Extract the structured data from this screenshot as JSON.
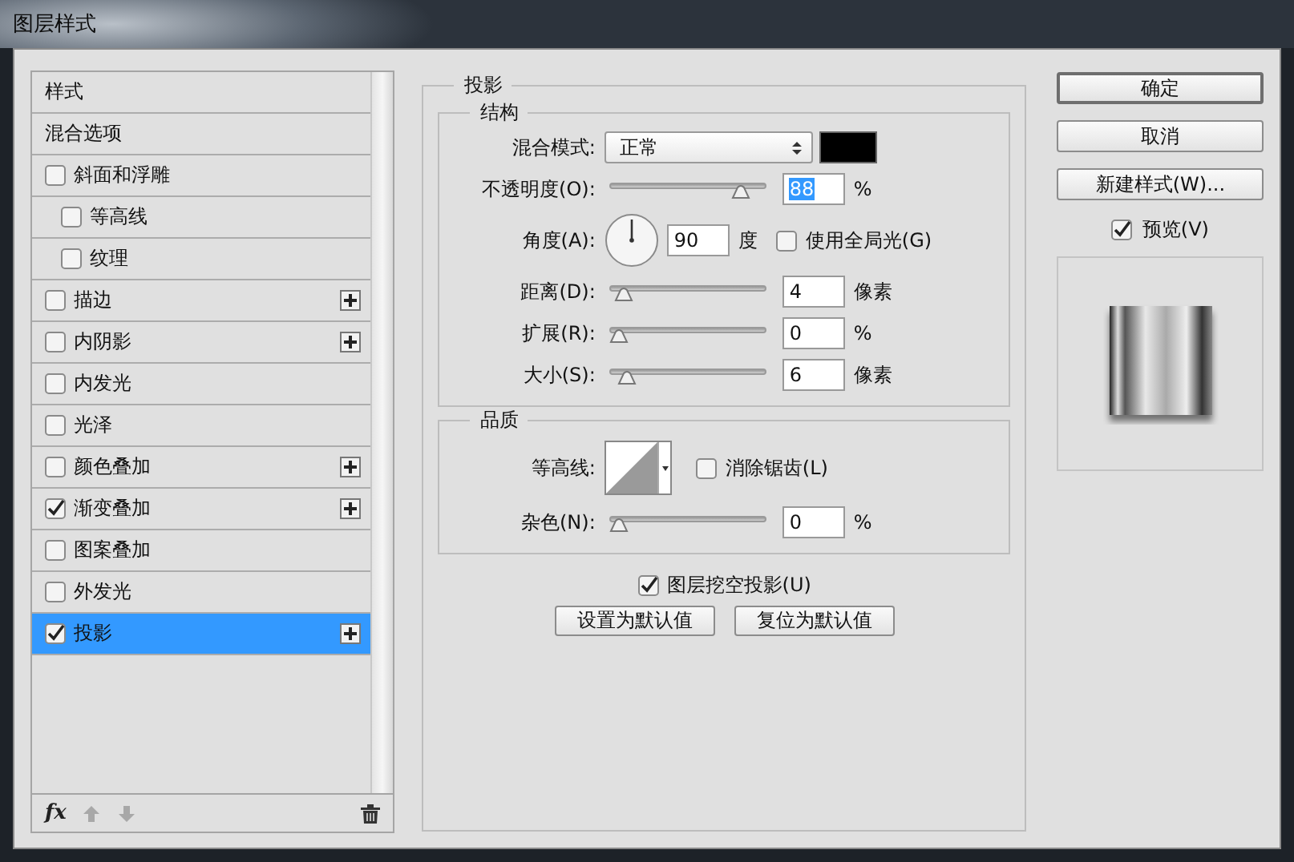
{
  "window": {
    "title": "图层样式"
  },
  "styles_list": {
    "items": [
      {
        "kind": "header",
        "label": "样式",
        "selected": false
      },
      {
        "kind": "header",
        "label": "混合选项",
        "selected": false
      },
      {
        "kind": "checkbox",
        "label": "斜面和浮雕",
        "checked": false,
        "selected": false,
        "addable": false,
        "children": [
          {
            "kind": "checkbox",
            "label": "等高线",
            "checked": false,
            "selected": false,
            "addable": false
          },
          {
            "kind": "checkbox",
            "label": "纹理",
            "checked": false,
            "selected": false,
            "addable": false
          }
        ]
      },
      {
        "kind": "checkbox",
        "label": "描边",
        "checked": false,
        "selected": false,
        "addable": true
      },
      {
        "kind": "checkbox",
        "label": "内阴影",
        "checked": false,
        "selected": false,
        "addable": true
      },
      {
        "kind": "checkbox",
        "label": "内发光",
        "checked": false,
        "selected": false,
        "addable": false
      },
      {
        "kind": "checkbox",
        "label": "光泽",
        "checked": false,
        "selected": false,
        "addable": false
      },
      {
        "kind": "checkbox",
        "label": "颜色叠加",
        "checked": false,
        "selected": false,
        "addable": true
      },
      {
        "kind": "checkbox",
        "label": "渐变叠加",
        "checked": true,
        "selected": false,
        "addable": true
      },
      {
        "kind": "checkbox",
        "label": "图案叠加",
        "checked": false,
        "selected": false,
        "addable": false
      },
      {
        "kind": "checkbox",
        "label": "外发光",
        "checked": false,
        "selected": false,
        "addable": false
      },
      {
        "kind": "checkbox",
        "label": "投影",
        "checked": true,
        "selected": true,
        "addable": true
      }
    ],
    "toolbar": {
      "fx": "fx"
    }
  },
  "panel": {
    "title": "投影",
    "structure": {
      "title": "结构",
      "blend_mode": {
        "label": "混合模式:",
        "value": "正常",
        "color": "#000000"
      },
      "opacity": {
        "label": "不透明度(O):",
        "level": 0.88,
        "value": "88",
        "value_selected": true,
        "unit": "%"
      },
      "angle": {
        "label": "角度(A):",
        "value": "90",
        "unit": "度",
        "global_light": {
          "label": "使用全局光(G)",
          "checked": false
        }
      },
      "distance": {
        "label": "距离(D):",
        "level": 0.03,
        "value": "4",
        "value_selected": false,
        "unit": "像素"
      },
      "spread": {
        "label": "扩展(R):",
        "level": 0,
        "value": "0",
        "value_selected": false,
        "unit": "%"
      },
      "size": {
        "label": "大小(S):",
        "level": 0.05,
        "value": "6",
        "value_selected": false,
        "unit": "像素"
      }
    },
    "quality": {
      "title": "品质",
      "contour": {
        "label": "等高线:"
      },
      "anti_alias": {
        "label": "消除锯齿(L)",
        "checked": false
      },
      "noise": {
        "label": "杂色(N):",
        "level": 0,
        "value": "0",
        "value_selected": false,
        "unit": "%"
      }
    },
    "knockout": {
      "label": "图层挖空投影(U)",
      "checked": true
    },
    "buttons": [
      "设置为默认值",
      "复位为默认值"
    ]
  },
  "side": {
    "buttons": [
      {
        "label": "确定",
        "default": true
      },
      {
        "label": "取消",
        "default": false
      },
      {
        "label": "新建样式(W)...",
        "default": false
      }
    ],
    "preview": {
      "label": "预览(V)",
      "checked": true
    }
  }
}
